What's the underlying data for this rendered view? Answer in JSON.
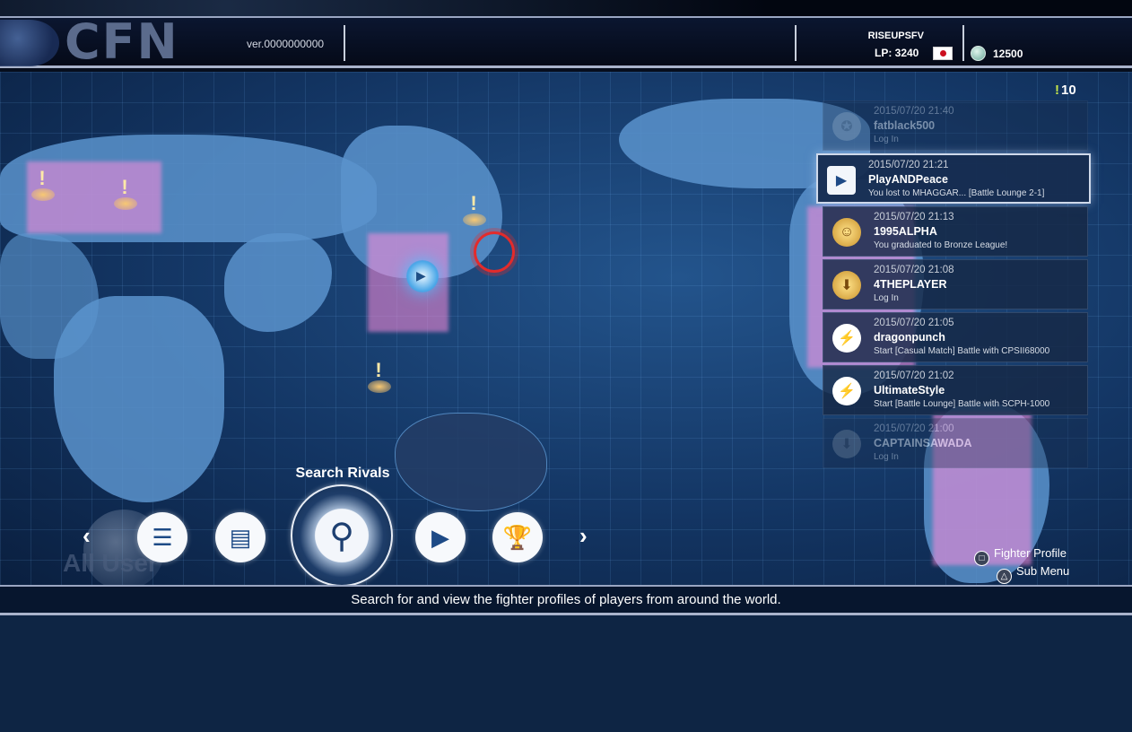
{
  "header": {
    "logo": "CFN",
    "version": "ver.0000000000",
    "username": "RISEUPSFV",
    "lp_label": "LP: 3240",
    "coins": "12500"
  },
  "notifications": {
    "count": "10",
    "items": [
      {
        "time": "2015/07/20 21:40",
        "name": "fatblack500",
        "message": "Log In",
        "icon": "gray-emblem-icon",
        "faded": true
      },
      {
        "time": "2015/07/20 21:21",
        "name": "PlayANDPeace",
        "message": "You lost to MHAGGAR... [Battle Lounge 2-1]",
        "icon": "video-icon",
        "selected": true
      },
      {
        "time": "2015/07/20 21:13",
        "name": "1995ALPHA",
        "message": "You graduated to Bronze League!",
        "icon": "league-emblem-icon"
      },
      {
        "time": "2015/07/20 21:08",
        "name": "4THEPLAYER",
        "message": "Log In",
        "icon": "login-emblem-icon"
      },
      {
        "time": "2015/07/20 21:05",
        "name": "dragonpunch",
        "message": "Start [Casual Match] Battle with CPSII68000",
        "icon": "battle-icon"
      },
      {
        "time": "2015/07/20 21:02",
        "name": "UltimateStyle",
        "message": "Start [Battle Lounge] Battle with SCPH-1000",
        "icon": "battle-icon"
      },
      {
        "time": "2015/07/20 21:00",
        "name": "CAPTAINSAWADA",
        "message": "Log In",
        "icon": "gray-emblem-icon",
        "faded": true
      }
    ]
  },
  "menu": {
    "selected_label": "Search Rivals",
    "items": [
      "clipboard-icon",
      "profile-card-icon",
      "search-icon",
      "replay-video-icon",
      "trophy-icon"
    ],
    "filter_label": "All User"
  },
  "controls": {
    "square_hint": "Fighter Profile",
    "triangle_hint": "Sub Menu"
  },
  "footer": {
    "description": "Search for and view the fighter profiles of players from around the world."
  },
  "colors": {
    "background": "#0d2544",
    "accent": "#5a93cc",
    "heat": "#ff8cdc",
    "alert": "#e32b2b"
  }
}
